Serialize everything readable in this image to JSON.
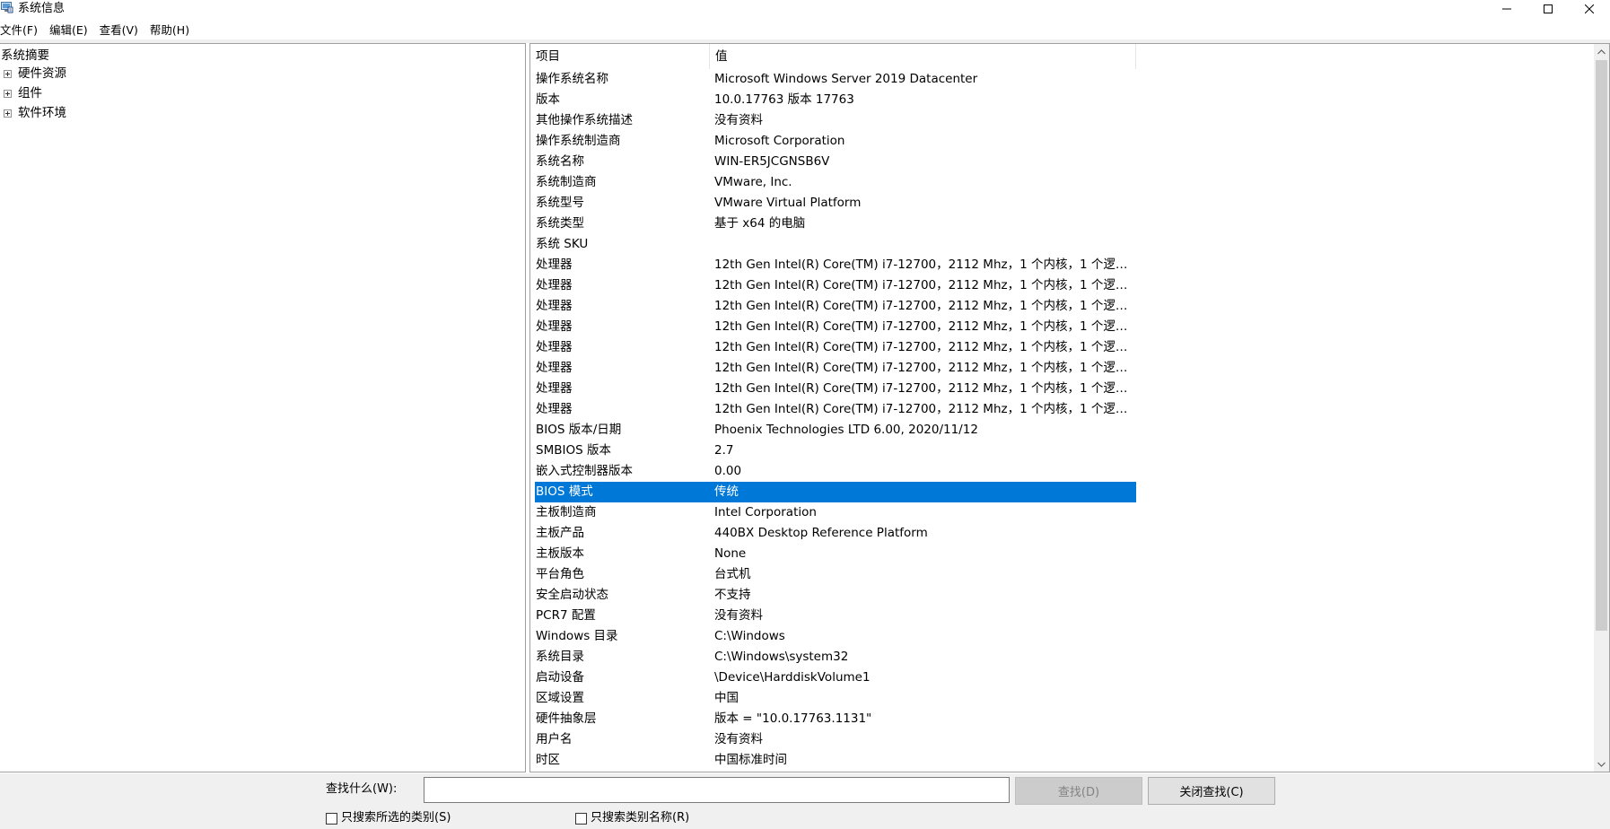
{
  "window": {
    "title": "系统信息",
    "menu": [
      "文件(F)",
      "编辑(E)",
      "查看(V)",
      "帮助(H)"
    ]
  },
  "tree": {
    "root": "系统摘要",
    "items": [
      "硬件资源",
      "组件",
      "软件环境"
    ]
  },
  "list": {
    "headers": {
      "item": "项目",
      "value": "值"
    },
    "rows": [
      {
        "item": "操作系统名称",
        "value": "Microsoft Windows Server 2019 Datacenter"
      },
      {
        "item": "版本",
        "value": "10.0.17763 版本 17763"
      },
      {
        "item": "其他操作系统描述",
        "value": "没有资料"
      },
      {
        "item": "操作系统制造商",
        "value": "Microsoft Corporation"
      },
      {
        "item": "系统名称",
        "value": "WIN-ER5JCGNSB6V"
      },
      {
        "item": "系统制造商",
        "value": "VMware, Inc."
      },
      {
        "item": "系统型号",
        "value": "VMware Virtual Platform"
      },
      {
        "item": "系统类型",
        "value": "基于 x64 的电脑"
      },
      {
        "item": "系统 SKU",
        "value": ""
      },
      {
        "item": "处理器",
        "value": "12th Gen Intel(R) Core(TM) i7-12700，2112 Mhz，1 个内核，1 个逻辑处..."
      },
      {
        "item": "处理器",
        "value": "12th Gen Intel(R) Core(TM) i7-12700，2112 Mhz，1 个内核，1 个逻辑处..."
      },
      {
        "item": "处理器",
        "value": "12th Gen Intel(R) Core(TM) i7-12700，2112 Mhz，1 个内核，1 个逻辑处..."
      },
      {
        "item": "处理器",
        "value": "12th Gen Intel(R) Core(TM) i7-12700，2112 Mhz，1 个内核，1 个逻辑处..."
      },
      {
        "item": "处理器",
        "value": "12th Gen Intel(R) Core(TM) i7-12700，2112 Mhz，1 个内核，1 个逻辑处..."
      },
      {
        "item": "处理器",
        "value": "12th Gen Intel(R) Core(TM) i7-12700，2112 Mhz，1 个内核，1 个逻辑处..."
      },
      {
        "item": "处理器",
        "value": "12th Gen Intel(R) Core(TM) i7-12700，2112 Mhz，1 个内核，1 个逻辑处..."
      },
      {
        "item": "处理器",
        "value": "12th Gen Intel(R) Core(TM) i7-12700，2112 Mhz，1 个内核，1 个逻辑处..."
      },
      {
        "item": "BIOS 版本/日期",
        "value": "Phoenix Technologies LTD 6.00, 2020/11/12"
      },
      {
        "item": "SMBIOS 版本",
        "value": "2.7"
      },
      {
        "item": "嵌入式控制器版本",
        "value": "0.00"
      },
      {
        "item": "BIOS 模式",
        "value": "传统",
        "selected": true
      },
      {
        "item": "主板制造商",
        "value": "Intel Corporation"
      },
      {
        "item": "主板产品",
        "value": "440BX Desktop Reference Platform"
      },
      {
        "item": "主板版本",
        "value": "None"
      },
      {
        "item": "平台角色",
        "value": "台式机"
      },
      {
        "item": "安全启动状态",
        "value": "不支持"
      },
      {
        "item": "PCR7 配置",
        "value": "没有资料"
      },
      {
        "item": "Windows 目录",
        "value": "C:\\Windows"
      },
      {
        "item": "系统目录",
        "value": "C:\\Windows\\system32"
      },
      {
        "item": "启动设备",
        "value": "\\Device\\HarddiskVolume1"
      },
      {
        "item": "区域设置",
        "value": "中国"
      },
      {
        "item": "硬件抽象层",
        "value": "版本 = \"10.0.17763.1131\""
      },
      {
        "item": "用户名",
        "value": "没有资料"
      },
      {
        "item": "时区",
        "value": "中国标准时间"
      }
    ]
  },
  "find": {
    "label": "查找什么(W):",
    "input_value": "",
    "find_button": "查找(D)",
    "close_button": "关闭查找(C)",
    "check_selected": "只搜索所选的类别(S)",
    "check_names": "只搜索类别名称(R)"
  },
  "colors": {
    "selection": "#0078d7",
    "chrome": "#f0f0f0"
  }
}
